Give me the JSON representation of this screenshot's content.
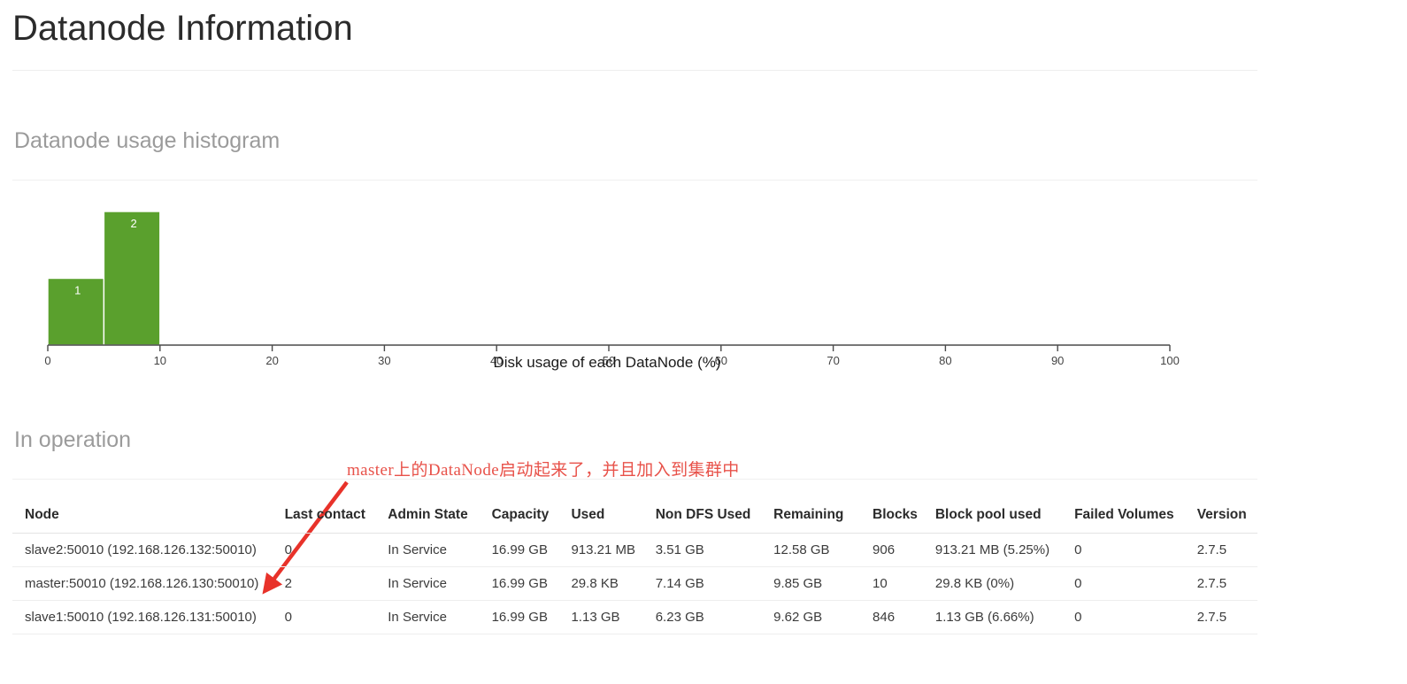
{
  "page": {
    "title": "Datanode Information"
  },
  "histogram": {
    "section_title": "Datanode usage histogram"
  },
  "chart_data": {
    "type": "bar",
    "title": "Datanode usage histogram",
    "xlabel": "Disk usage of each DataNode (%)",
    "ylabel": "",
    "xlim": [
      0,
      100
    ],
    "ylim": [
      0,
      2
    ],
    "grid": false,
    "legend": null,
    "bin_width": 5,
    "categories": [
      "0-5",
      "5-10"
    ],
    "bin_edges": [
      [
        0,
        5
      ],
      [
        5,
        10
      ]
    ],
    "values": [
      1,
      2
    ],
    "bar_labels": [
      "1",
      "2"
    ],
    "bar_color": "#5aa02d",
    "xticks": [
      0,
      10,
      20,
      30,
      40,
      50,
      60,
      70,
      80,
      90,
      100
    ],
    "xtick_labels": [
      "0",
      "10",
      "20",
      "30",
      "40",
      "50",
      "60",
      "70",
      "80",
      "90",
      "100"
    ]
  },
  "in_operation": {
    "section_title": "In operation",
    "annotation": "master上的DataNode启动起来了，并且加入到集群中",
    "annotation_color": "#e8524a",
    "columns": [
      "Node",
      "Last contact",
      "Admin State",
      "Capacity",
      "Used",
      "Non DFS Used",
      "Remaining",
      "Blocks",
      "Block pool used",
      "Failed Volumes",
      "Version"
    ],
    "rows": [
      {
        "node": "slave2:50010 (192.168.126.132:50010)",
        "last_contact": "0",
        "admin_state": "In Service",
        "capacity": "16.99 GB",
        "used": "913.21 MB",
        "non_dfs_used": "3.51 GB",
        "remaining": "12.58 GB",
        "blocks": "906",
        "block_pool_used": "913.21 MB (5.25%)",
        "failed_volumes": "0",
        "version": "2.7.5"
      },
      {
        "node": "master:50010 (192.168.126.130:50010)",
        "last_contact": "2",
        "admin_state": "In Service",
        "capacity": "16.99 GB",
        "used": "29.8 KB",
        "non_dfs_used": "7.14 GB",
        "remaining": "9.85 GB",
        "blocks": "10",
        "block_pool_used": "29.8 KB (0%)",
        "failed_volumes": "0",
        "version": "2.7.5"
      },
      {
        "node": "slave1:50010 (192.168.126.131:50010)",
        "last_contact": "0",
        "admin_state": "In Service",
        "capacity": "16.99 GB",
        "used": "1.13 GB",
        "non_dfs_used": "6.23 GB",
        "remaining": "9.62 GB",
        "blocks": "846",
        "block_pool_used": "1.13 GB (6.66%)",
        "failed_volumes": "0",
        "version": "2.7.5"
      }
    ]
  }
}
